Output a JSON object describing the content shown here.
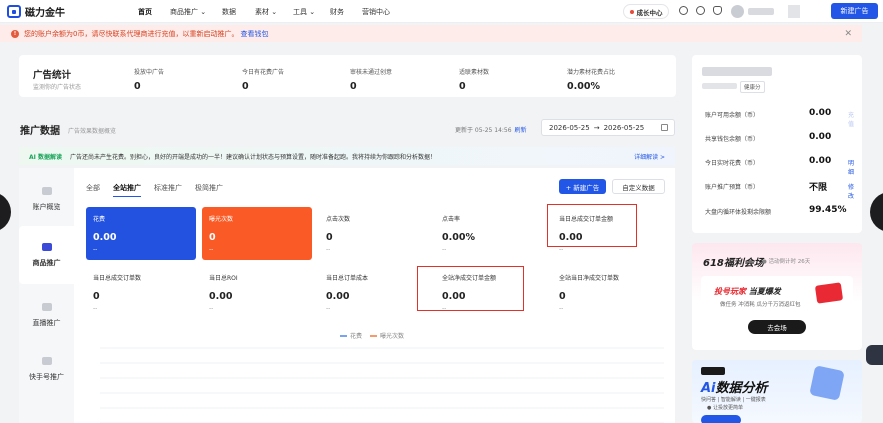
{
  "brand": {
    "name": "磁力金牛",
    "color": "#1f4fe0"
  },
  "topnav": {
    "items": [
      "首页",
      "商品推广 ⌄",
      "数据",
      "素材 ⌄",
      "工具 ⌄",
      "财务",
      "营销中心"
    ],
    "growth_label": "成长中心",
    "new_ad_label": "新建广告"
  },
  "notice": {
    "text": "您的账户余额为0币，请尽快联系代理商进行充值，以重新启动推广。",
    "link": "查看钱包",
    "icon": "warning-icon"
  },
  "stats": {
    "title": "广告统计",
    "subtitle": "监测你的广告状态",
    "items": [
      {
        "label": "投放中广告",
        "value": "0"
      },
      {
        "label": "今日有花费广告",
        "value": "0"
      },
      {
        "label": "审核未通过创意",
        "value": "0"
      },
      {
        "label": "适联素材数",
        "value": "0"
      },
      {
        "label": "潜力素材花费占比",
        "value": "0.00%"
      }
    ]
  },
  "data_header": {
    "title": "推广数据",
    "subtitle": "广告效果数据概览",
    "update_text": "更新于 05-25 14:56",
    "refresh_label": "刷新",
    "date_start": "2026-05-25",
    "date_sep": "→",
    "date_end": "2026-05-25"
  },
  "ai_banner": {
    "tag": "AI 数据解读",
    "text": "广告还尚未产生花费。别担心，良好的开端是成功的一半！建议确认计划状态与预算设置，随时准备起跑。我将持续为你跟踪和分析数据！",
    "detail": "详细解读 >"
  },
  "side_tabs": [
    "账户概览",
    "商品推广",
    "直播推广",
    "快手号推广"
  ],
  "tabs": [
    "全部",
    "全站推广",
    "标准推广",
    "极简推广"
  ],
  "buttons": {
    "new": "+ 新建广告",
    "custom": "自定义数据"
  },
  "metrics": [
    {
      "label": "花费",
      "value": "0.00",
      "delta": "--"
    },
    {
      "label": "曝光次数",
      "value": "0",
      "delta": "--"
    },
    {
      "label": "点击次数",
      "value": "0",
      "delta": "--"
    },
    {
      "label": "点击率",
      "value": "0.00%",
      "delta": "--"
    },
    {
      "label": "当日总成交订单金额",
      "value": "0.00",
      "delta": "--"
    },
    {
      "label": "当日总成交订单数",
      "value": "0",
      "delta": "--"
    },
    {
      "label": "当日总ROI",
      "value": "0.00",
      "delta": "--"
    },
    {
      "label": "当日总订单成本",
      "value": "0.00",
      "delta": "--"
    },
    {
      "label": "全站净成交订单金额",
      "value": "0.00",
      "delta": "--"
    },
    {
      "label": "全站当日净成交订单数",
      "value": "0",
      "delta": "--"
    }
  ],
  "legend": [
    {
      "name": "花费",
      "color": "#7aa2f2"
    },
    {
      "name": "曝光次数",
      "color": "#f79a6b"
    }
  ],
  "account": {
    "tag": "健康分",
    "rows": [
      {
        "label": "账户可用余额（币）",
        "value": "0.00",
        "link": "充值"
      },
      {
        "label": "共享钱包余额（币）",
        "value": "0.00",
        "link": ""
      },
      {
        "label": "今日实时花费（币）",
        "value": "0.00",
        "link": "明细"
      },
      {
        "label": "账户推广预算（币）",
        "value": "不限",
        "link": "修改"
      },
      {
        "label": "大盘内循环体投剩余限额",
        "value": "99.45%",
        "link": ""
      }
    ]
  },
  "promo1": {
    "title": "618福利会场",
    "sub": "● 活动倒计时 26天",
    "head_red": "投号玩家",
    "head_dark": "当夏爆发",
    "desc": "做任务  冲消耗  瓜分千万消返红包",
    "button": "去会场"
  },
  "promo2": {
    "title_ai": "Ai",
    "title": "数据分析",
    "sub": "快问答  |  智能解读  |  一键报表",
    "sub2": "● 让投放更简单"
  }
}
